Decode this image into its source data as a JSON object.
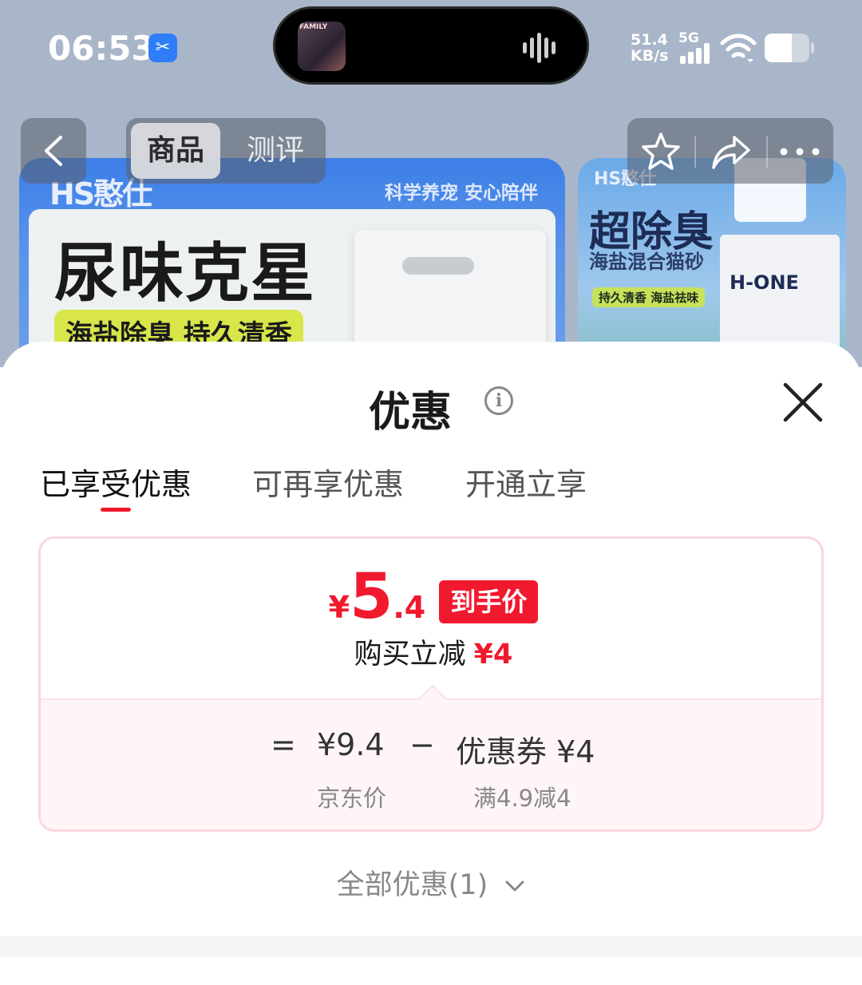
{
  "status_bar": {
    "time": "06:53",
    "net_speed_value": "51.4",
    "net_speed_unit": "KB/s",
    "network_type": "5G",
    "screen_app_icon": "scissors-icon",
    "album_text": "FAMILY",
    "battery_level": 0.6
  },
  "background_page": {
    "tabs": [
      "商品",
      "测评"
    ],
    "active_tab": "商品",
    "action_icons": [
      "star-icon",
      "share-icon",
      "more-icon"
    ],
    "banner_main": {
      "logo": "HS憨仕",
      "slogan": "科学养宠 安心陪伴",
      "headline": "尿味克星",
      "subline": "海盐除臭 持久清香"
    },
    "banner_side": {
      "logo": "HS憨仕",
      "headline": "超除臭",
      "subline": "海盐混合猫砂",
      "tagline": "持久清香 海盐祛味",
      "brand": "H-ONE"
    }
  },
  "sheet": {
    "title": "优惠",
    "info_icon": "info-icon",
    "close_icon": "close-icon",
    "tabs": [
      {
        "label": "已享受优惠",
        "active": true
      },
      {
        "label": "可再享优惠",
        "active": false
      },
      {
        "label": "开通立享",
        "active": false
      }
    ],
    "price_card": {
      "currency": "¥",
      "final_price_int": "5",
      "final_price_dec": ".4",
      "final_badge": "到手价",
      "instant_label": "购买立减",
      "instant_amount": "¥4",
      "equals": "=",
      "base_price": "¥9.4",
      "base_label": "京东价",
      "minus": "−",
      "coupon": "优惠券 ¥4",
      "coupon_condition": "满4.9减4"
    },
    "all_discounts": "全部优惠(1)"
  },
  "colors": {
    "accent_red": "#f0192e",
    "card_border": "#fbd7dd",
    "breakdown_bg": "#fff5f7",
    "overlay": "#a9b6c9"
  }
}
